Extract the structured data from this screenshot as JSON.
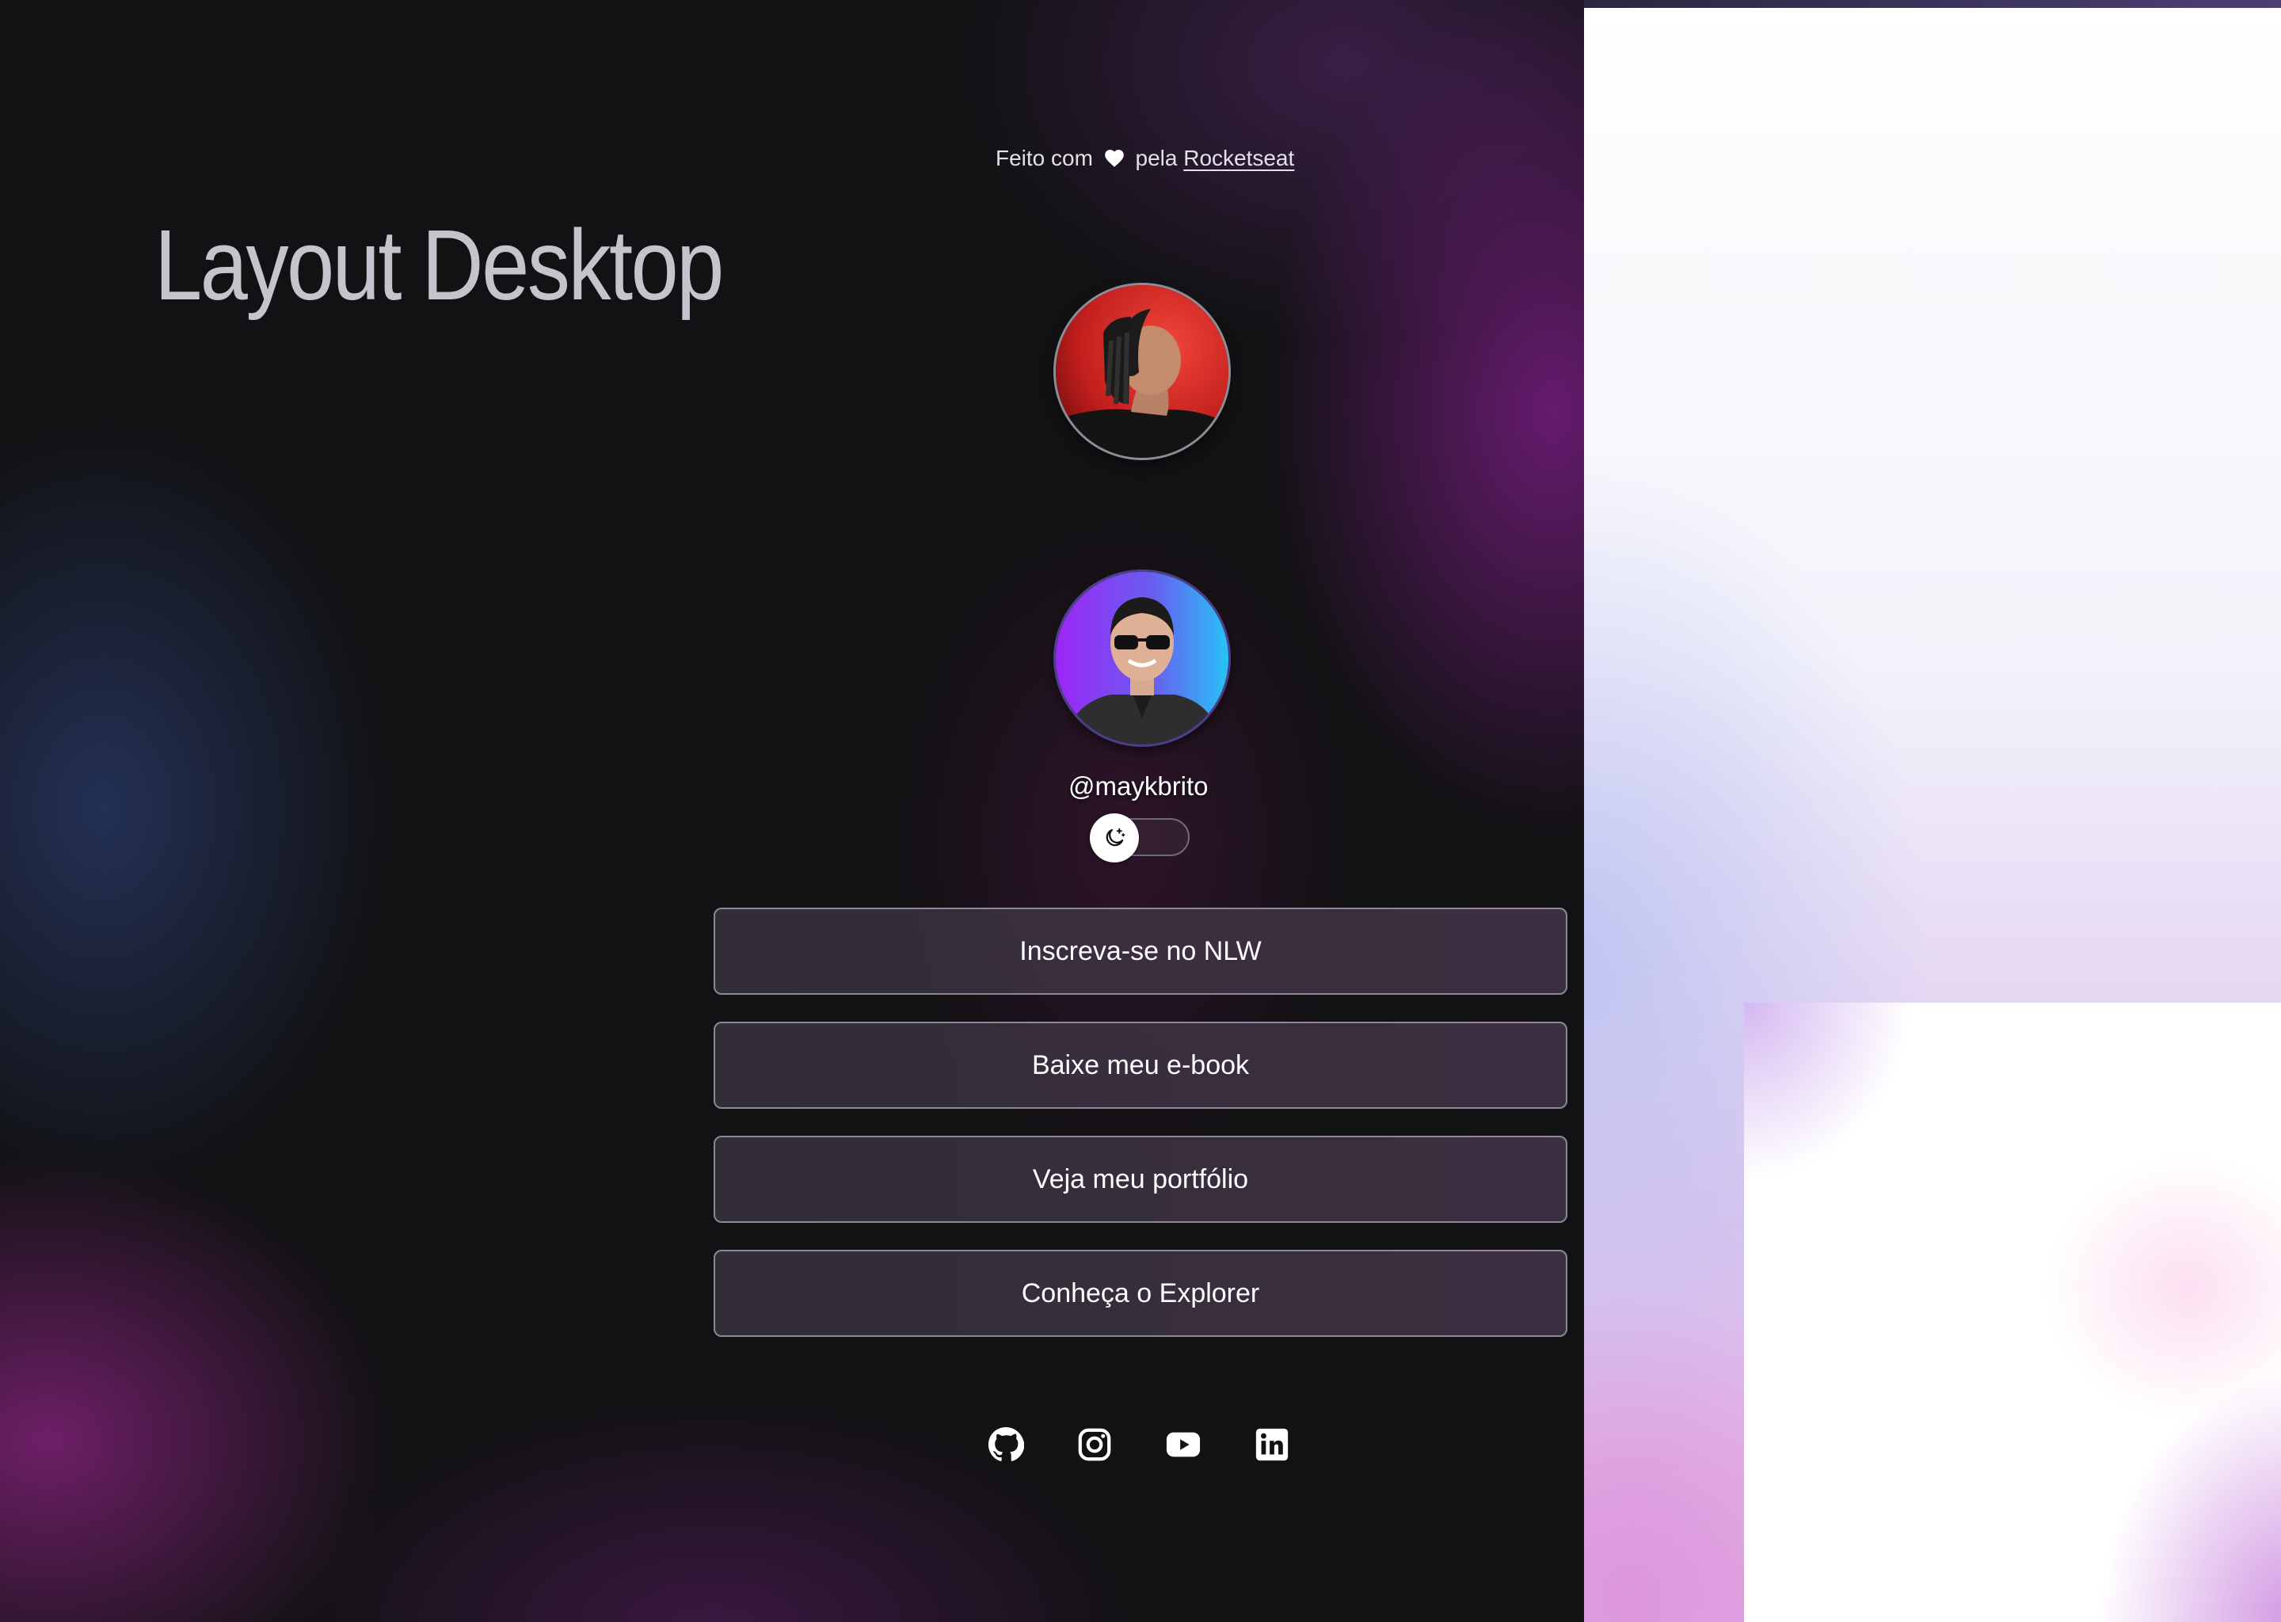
{
  "page": {
    "heading": "Layout Desktop"
  },
  "credit": {
    "prefix": "Feito com",
    "heart_icon": "heart-icon",
    "middle": "pela",
    "link_label": "Rocketseat"
  },
  "profile": {
    "avatar_top": "avatar-photo-profile-side",
    "avatar_bottom": "avatar-photo-sunglasses",
    "username": "@maykbrito"
  },
  "theme_switch": {
    "icon": "moon-stars-icon",
    "state": "dark"
  },
  "links": [
    {
      "label": "Inscreva-se no NLW"
    },
    {
      "label": "Baixe meu e-book"
    },
    {
      "label": "Veja meu portfólio"
    },
    {
      "label": "Conheça o Explorer"
    }
  ],
  "social": [
    {
      "icon": "github-icon"
    },
    {
      "icon": "instagram-icon"
    },
    {
      "icon": "youtube-icon"
    },
    {
      "icon": "linkedin-icon"
    }
  ],
  "colors": {
    "background": "#121214",
    "accent_purple": "#8257e5",
    "text_primary": "#ffffff",
    "text_muted": "#c4c4cc"
  }
}
